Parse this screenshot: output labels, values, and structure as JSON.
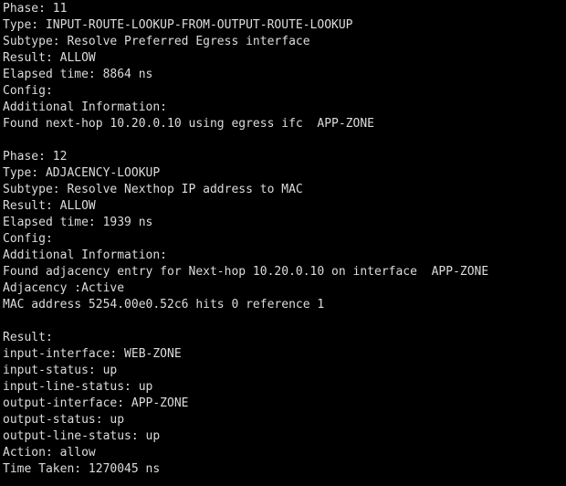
{
  "terminal": {
    "lines": [
      "Phase: 11",
      "Type: INPUT-ROUTE-LOOKUP-FROM-OUTPUT-ROUTE-LOOKUP",
      "Subtype: Resolve Preferred Egress interface",
      "Result: ALLOW",
      "Elapsed time: 8864 ns",
      "Config:",
      "Additional Information:",
      "Found next-hop 10.20.0.10 using egress ifc  APP-ZONE",
      "",
      "Phase: 12",
      "Type: ADJACENCY-LOOKUP",
      "Subtype: Resolve Nexthop IP address to MAC",
      "Result: ALLOW",
      "Elapsed time: 1939 ns",
      "Config:",
      "Additional Information:",
      "Found adjacency entry for Next-hop 10.20.0.10 on interface  APP-ZONE",
      "Adjacency :Active",
      "MAC address 5254.00e0.52c6 hits 0 reference 1",
      "",
      "Result:",
      "input-interface: WEB-ZONE",
      "input-status: up",
      "input-line-status: up",
      "output-interface: APP-ZONE",
      "output-status: up",
      "output-line-status: up",
      "Action: allow",
      "Time Taken: 1270045 ns"
    ],
    "colors": {
      "background": "#000000",
      "text": "#dcdcdc"
    }
  }
}
